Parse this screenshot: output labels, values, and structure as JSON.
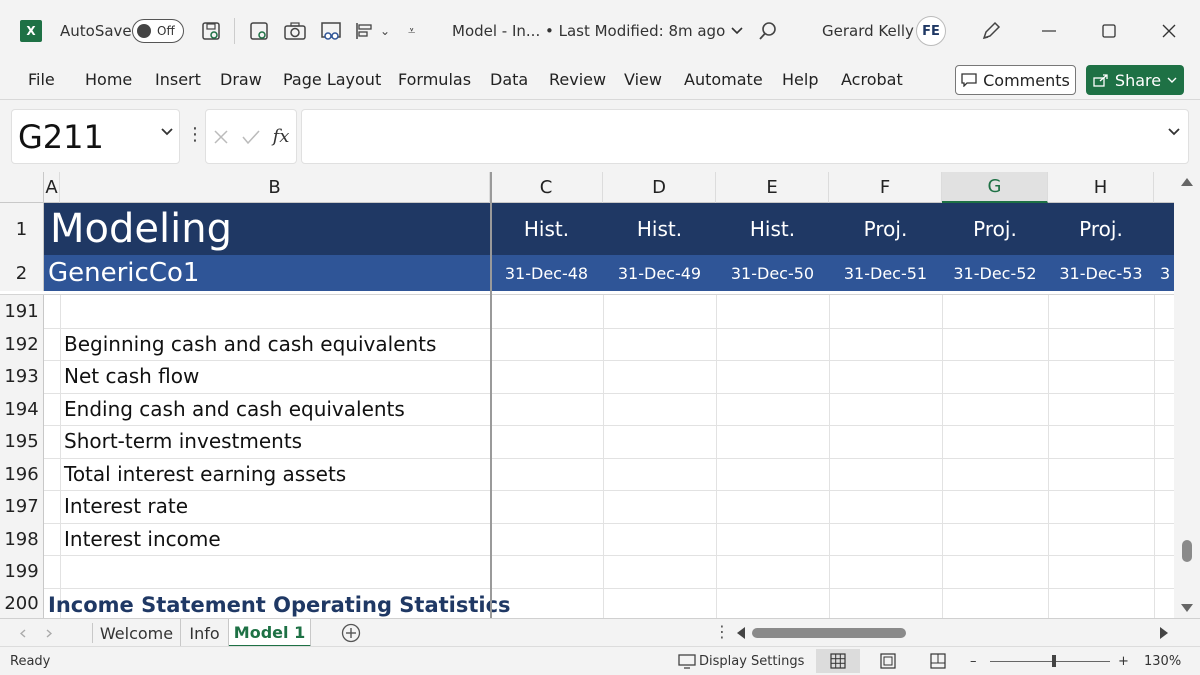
{
  "titlebar": {
    "app_icon": "excel-icon",
    "app_letter": "X",
    "autosave_label": "AutoSave",
    "autosave_state": "Off",
    "doc_title": "Model - In... • Last Modified: 8m ago",
    "user_name": "Gerard Kelly",
    "avatar_initials": "FE"
  },
  "ribbon": {
    "tabs": [
      "File",
      "Home",
      "Insert",
      "Draw",
      "Page Layout",
      "Formulas",
      "Data",
      "Review",
      "View",
      "Automate",
      "Help",
      "Acrobat"
    ],
    "comments_label": "Comments",
    "share_label": "Share"
  },
  "formula_bar": {
    "name_box": "G211",
    "fx_label": "fx",
    "formula_value": ""
  },
  "grid": {
    "columns": [
      "A",
      "B",
      "C",
      "D",
      "E",
      "F",
      "G",
      "H"
    ],
    "selected_column": "G",
    "frozen_rows": [
      "1",
      "2"
    ],
    "title": "Modeling",
    "subtitle": "GenericCo1",
    "period_types": [
      "Hist.",
      "Hist.",
      "Hist.",
      "Proj.",
      "Proj.",
      "Proj."
    ],
    "period_dates": [
      "31-Dec-48",
      "31-Dec-49",
      "31-Dec-50",
      "31-Dec-51",
      "31-Dec-52",
      "31-Dec-53"
    ],
    "overflow_char": "3",
    "rows": [
      {
        "num": "191",
        "label": ""
      },
      {
        "num": "192",
        "label": "Beginning cash and cash equivalents"
      },
      {
        "num": "193",
        "label": "Net cash flow"
      },
      {
        "num": "194",
        "label": "Ending cash and cash equivalents"
      },
      {
        "num": "195",
        "label": "Short-term investments"
      },
      {
        "num": "196",
        "label": "Total interest earning assets"
      },
      {
        "num": "197",
        "label": "Interest rate"
      },
      {
        "num": "198",
        "label": "Interest income"
      },
      {
        "num": "199",
        "label": ""
      },
      {
        "num": "200",
        "label": "Income Statement Operating Statistics"
      }
    ]
  },
  "sheets": {
    "tabs": [
      "Welcome",
      "Info",
      "Model 1"
    ],
    "active": "Model 1"
  },
  "status": {
    "ready": "Ready",
    "display_settings": "Display Settings",
    "zoom_minus": "–",
    "zoom_plus": "+",
    "zoom": "130%"
  }
}
